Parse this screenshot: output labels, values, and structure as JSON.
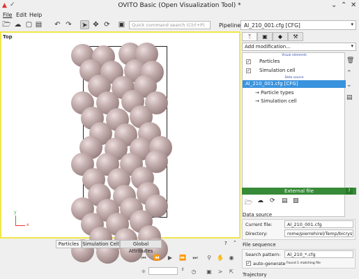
{
  "window": {
    "title": "OVITO Basic (Open Visualization Tool) *",
    "minimize_icon": "chevron-down-icon",
    "maximize_icon": "chevron-up-icon",
    "close_icon": "close-icon"
  },
  "menubar": {
    "items": [
      {
        "label": "File"
      },
      {
        "label": "Edit"
      },
      {
        "label": "Help"
      }
    ]
  },
  "toolbar": {
    "search_placeholder": "Quick command search (Ctrl+P)",
    "pipelines_label": "Pipelines:",
    "pipeline_selected": "Al_210_001.cfg [CFG]"
  },
  "viewport": {
    "label": "Top",
    "axis_x": "x",
    "axis_y": "y",
    "atom_color": "#b9a3a3",
    "highlight_color": "#f1e64b"
  },
  "bottom_tabs": [
    {
      "label": "Particles"
    },
    {
      "label": "Simulation Cell"
    },
    {
      "label": "Global Attributes"
    }
  ],
  "panel": {
    "add_modification": "Add modification...",
    "visual_elements_header": "Visual elements",
    "data_source_header": "Data source",
    "visual_elements": [
      {
        "label": "Particles",
        "checked": true
      },
      {
        "label": "Simulation cell",
        "checked": true
      }
    ],
    "data_source_items": [
      {
        "label": "Al_210_001.cfg [CFG]",
        "selected": true
      },
      {
        "label": "→ Particle types"
      },
      {
        "label": "→ Simulation cell"
      }
    ]
  },
  "external_file": {
    "title": "External file",
    "help": "?",
    "data_source_label": "Data source",
    "current_file_label": "Current file:",
    "current_file": "Al_210_001.cfg",
    "directory_label": "Directory:",
    "directory": "rome/pierrehirel/Temp/bicrystal",
    "file_sequence_label": "File sequence",
    "search_pattern_label": "Search pattern:",
    "search_pattern": "Al_210_*.cfg",
    "autogenerate_label": "auto-generate",
    "autogenerate_checked": true,
    "found_text": "Found 1 matching file",
    "trajectory_label": "Trajectory"
  }
}
